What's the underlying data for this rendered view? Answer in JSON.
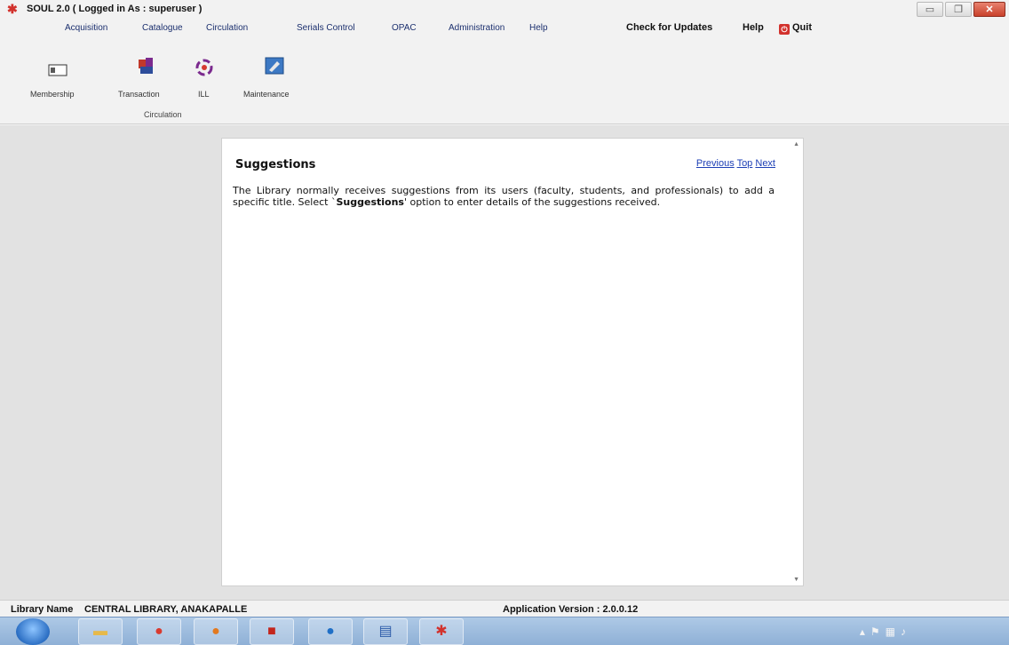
{
  "window": {
    "title": "SOUL 2.0  ( Logged in As : superuser )",
    "controls": {
      "minimize": "▭",
      "restore": "❐",
      "close": "✕"
    }
  },
  "menu": {
    "items": [
      "Acquisition",
      "Catalogue",
      "Circulation",
      "Serials Control",
      "OPAC",
      "Administration",
      "Help"
    ],
    "check_updates": "Check for Updates",
    "help": "Help",
    "quit": "Quit"
  },
  "ribbon": {
    "buttons": [
      {
        "label": "Membership",
        "icon": "membership-icon"
      },
      {
        "label": "Transaction",
        "icon": "transaction-icon"
      },
      {
        "label": "ILL",
        "icon": "ill-icon"
      },
      {
        "label": "Maintenance",
        "icon": "maintenance-icon"
      }
    ],
    "group_label": "Circulation"
  },
  "document": {
    "title": "Suggestions",
    "nav": {
      "previous": "Previous",
      "top": "Top",
      "next": "Next"
    },
    "body_before": "The Library normally receives suggestions from its users (faculty, students, and professionals) to add a specific title.  Select `",
    "body_bold": "Suggestions",
    "body_after": "' option to enter details of the suggestions received."
  },
  "status": {
    "library_label": "Library Name",
    "library_name": "CENTRAL LIBRARY, ANAKAPALLE",
    "version": "Application Version : 2.0.0.12"
  },
  "taskbar": {
    "apps": [
      "explorer-icon",
      "chrome-icon",
      "firefox-icon",
      "acrobat-icon",
      "chrome-canary-icon",
      "word-icon",
      "soul-icon"
    ]
  },
  "colors": {
    "accent": "#1b2f6e",
    "quit": "#d2322d",
    "link": "#1d3fb5"
  }
}
